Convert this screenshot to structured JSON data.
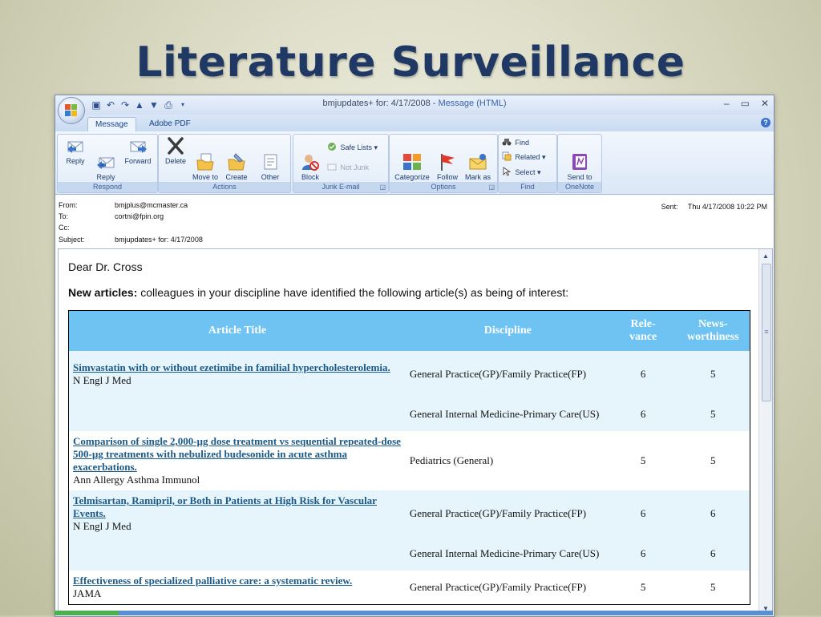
{
  "slide": {
    "title": "Literature Surveillance"
  },
  "window": {
    "title_prefix": "bmjupdates+ for: 4/17/2008",
    "title_sep": "-",
    "title_suffix": "Message (HTML)",
    "controls": {
      "minimize": "–",
      "restore": "▭",
      "close": "✕"
    }
  },
  "tabs": [
    {
      "label": "Message"
    },
    {
      "label": "Adobe PDF"
    }
  ],
  "ribbon": {
    "respond": {
      "label": "Respond",
      "reply": "Reply",
      "reply_all": "Reply\nto All",
      "forward": "Forward"
    },
    "actions": {
      "label": "Actions",
      "delete": "Delete",
      "move": "Move to\nFolder ▾",
      "create_rule": "Create\nRule",
      "other": "Other\nActions ▾"
    },
    "junk": {
      "label": "Junk E-mail",
      "block": "Block\nSender",
      "safe_lists": "Safe Lists ▾",
      "not_junk": "Not Junk"
    },
    "options": {
      "label": "Options",
      "categorize": "Categorize\n▾",
      "follow_up": "Follow\nUp ▾",
      "mark_unread": "Mark as\nUnread"
    },
    "find": {
      "label": "Find",
      "find": "Find",
      "related": "Related ▾",
      "select": "Select ▾"
    },
    "onenote": {
      "label": "OneNote",
      "send": "Send to\nOneNote"
    }
  },
  "headers": {
    "from_label": "From:",
    "from": "bmjplus@mcmaster.ca",
    "to_label": "To:",
    "to": "cortni@fpin.org",
    "cc_label": "Cc:",
    "cc": "",
    "subject_label": "Subject:",
    "subject": "bmjupdates+ for: 4/17/2008",
    "sent_label": "Sent:",
    "sent": "Thu 4/17/2008 10:22 PM"
  },
  "body": {
    "greeting": "Dear Dr. Cross",
    "intro_bold": "New articles:",
    "intro_rest": " colleagues in your discipline have identified the following article(s) as being of interest:",
    "columns": {
      "title": "Article Title",
      "discipline": "Discipline",
      "relevance": "Rele-\nvance",
      "news": "News-\nworthiness"
    },
    "rows": [
      {
        "title": "Simvastatin with or without ezetimibe in familial hypercholesterolemia.",
        "journal": "N Engl J Med",
        "discipline": "General Practice(GP)/Family Practice(FP)",
        "relevance": "6",
        "news": "5"
      },
      {
        "title": "",
        "journal": "",
        "discipline": "General Internal Medicine-Primary Care(US)",
        "relevance": "6",
        "news": "5"
      },
      {
        "title": "Comparison of single 2,000-µg dose treatment vs sequential repeated-dose 500-µg treatments with nebulized budesonide in acute asthma exacerbations.",
        "journal": "Ann Allergy Asthma Immunol",
        "discipline": "Pediatrics (General)",
        "relevance": "5",
        "news": "5"
      },
      {
        "title": "Telmisartan, Ramipril, or Both in Patients at High Risk for Vascular Events.",
        "journal": "N Engl J Med",
        "discipline": "General Practice(GP)/Family Practice(FP)",
        "relevance": "6",
        "news": "6"
      },
      {
        "title": "",
        "journal": "",
        "discipline": "General Internal Medicine-Primary Care(US)",
        "relevance": "6",
        "news": "6"
      },
      {
        "title": "Effectiveness of specialized palliative care: a systematic review.",
        "journal": "JAMA",
        "discipline": "General Practice(GP)/Family Practice(FP)",
        "relevance": "5",
        "news": "5"
      }
    ]
  },
  "colors": {
    "title": "#1f3864",
    "table_header": "#6fc3f3",
    "row_shade": "#e6f4fc",
    "link": "#1a5a8a"
  }
}
